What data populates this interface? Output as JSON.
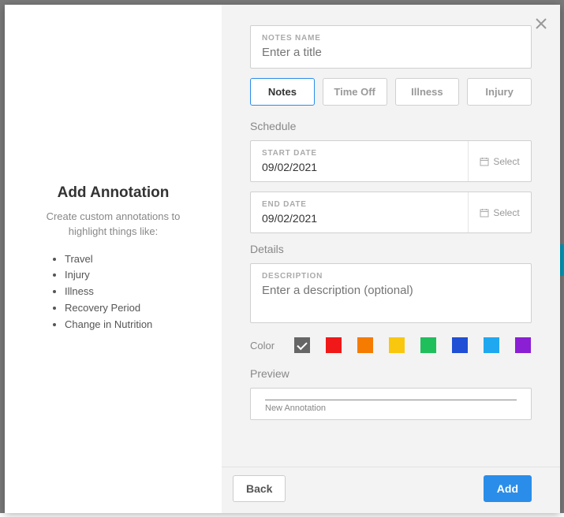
{
  "left": {
    "title": "Add Annotation",
    "subtitle": "Create custom annotations to highlight things like:",
    "items": [
      "Travel",
      "Injury",
      "Illness",
      "Recovery Period",
      "Change in Nutrition"
    ]
  },
  "form": {
    "notes_name_label": "NOTES NAME",
    "notes_name_placeholder": "Enter a title",
    "tabs": [
      "Notes",
      "Time Off",
      "Illness",
      "Injury"
    ],
    "schedule_label": "Schedule",
    "start_date_label": "START DATE",
    "start_date_value": "09/02/2021",
    "end_date_label": "END DATE",
    "end_date_value": "09/02/2021",
    "select_label": "Select",
    "details_label": "Details",
    "description_label": "DESCRIPTION",
    "description_placeholder": "Enter a description (optional)",
    "color_label": "Color",
    "colors": [
      "#666666",
      "#f01818",
      "#f57c00",
      "#f9c80e",
      "#1fbf5c",
      "#1f4fd4",
      "#1fa8f0",
      "#8a1fd4"
    ],
    "preview_label": "Preview",
    "preview_text": "New Annotation"
  },
  "footer": {
    "back": "Back",
    "add": "Add"
  }
}
